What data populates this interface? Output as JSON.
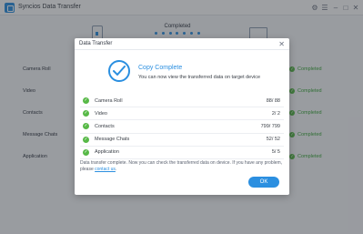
{
  "app": {
    "title": "Syncios Data Transfer",
    "controls": [
      "⚙",
      "☰",
      "–",
      "□",
      "✕"
    ]
  },
  "background": {
    "status_text": "Completed",
    "rows": [
      {
        "label": "Camera Roll",
        "status": "Completed"
      },
      {
        "label": "Video",
        "status": "Completed"
      },
      {
        "label": "Contacts",
        "status": "Completed"
      },
      {
        "label": "Message Chats",
        "status": "Completed"
      },
      {
        "label": "Application",
        "status": "Completed"
      }
    ]
  },
  "dialog": {
    "title": "Data Transfer",
    "close": "✕",
    "heading": "Copy Complete",
    "subheading": "You can now view the transferred data on target device",
    "items": [
      {
        "label": "Camera Roll",
        "count": "88/ 88"
      },
      {
        "label": "Video",
        "count": "2/ 2"
      },
      {
        "label": "Contacts",
        "count": "799/ 799"
      },
      {
        "label": "Message Chats",
        "count": "52/ 52"
      },
      {
        "label": "Application",
        "count": "5/ 5"
      }
    ],
    "note_prefix": "Data transfer complete. Now you can check the transferred data on device. If you have any problem, please",
    "note_link": "contact us",
    "note_suffix": ".",
    "ok": "OK"
  },
  "colors": {
    "accent": "#2b8fe0",
    "success": "#57b947"
  }
}
